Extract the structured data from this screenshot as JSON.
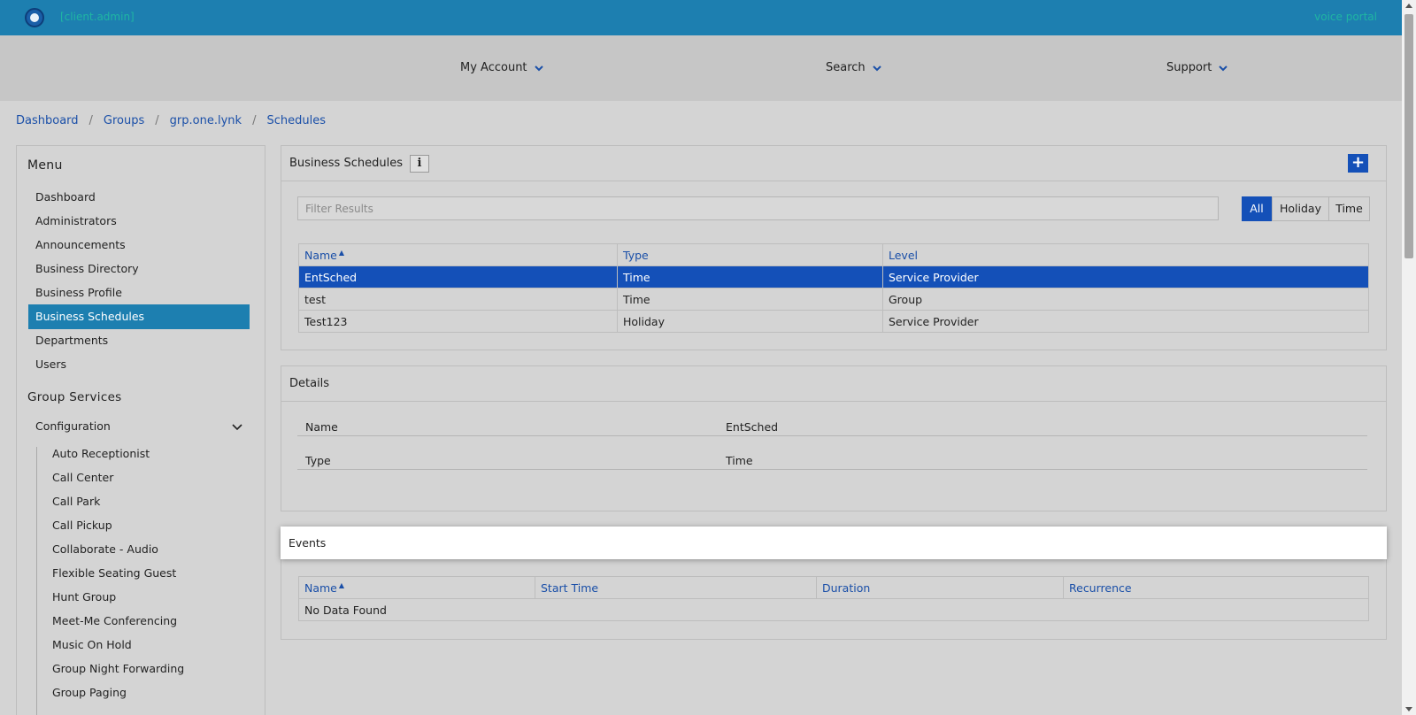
{
  "header": {
    "user": "[client.admin]",
    "portal": "voice portal"
  },
  "nav": [
    {
      "label": "My Account"
    },
    {
      "label": "Search"
    },
    {
      "label": "Support"
    }
  ],
  "breadcrumb": [
    "Dashboard",
    "Groups",
    "grp.one.lynk",
    "Schedules"
  ],
  "sidebar": {
    "menu_title": "Menu",
    "items": [
      "Dashboard",
      "Administrators",
      "Announcements",
      "Business Directory",
      "Business Profile",
      "Business Schedules",
      "Departments",
      "Users"
    ],
    "active_item": "Business Schedules",
    "group_services_title": "Group Services",
    "configuration_label": "Configuration",
    "sub_items": [
      "Auto Receptionist",
      "Call Center",
      "Call Park",
      "Call Pickup",
      "Collaborate - Audio",
      "Flexible Seating Guest",
      "Hunt Group",
      "Meet-Me Conferencing",
      "Music On Hold",
      "Group Night Forwarding",
      "Group Paging"
    ]
  },
  "schedules_panel": {
    "title": "Business Schedules",
    "info_label": "i",
    "add_label": "+",
    "filter_placeholder": "Filter Results",
    "filters": [
      "All",
      "Holiday",
      "Time"
    ],
    "active_filter": "All",
    "columns": [
      "Name",
      "Type",
      "Level"
    ],
    "rows": [
      {
        "name": "EntSched",
        "type": "Time",
        "level": "Service Provider"
      },
      {
        "name": "test",
        "type": "Time",
        "level": "Group"
      },
      {
        "name": "Test123",
        "type": "Holiday",
        "level": "Service Provider"
      }
    ],
    "selected_row": 0
  },
  "details_panel": {
    "title": "Details",
    "fields": [
      {
        "label": "Name",
        "value": "EntSched"
      },
      {
        "label": "Type",
        "value": "Time"
      }
    ]
  },
  "events_panel": {
    "title": "Events",
    "columns": [
      "Name",
      "Start Time",
      "Duration",
      "Recurrence"
    ],
    "empty_text": "No Data Found"
  },
  "colors": {
    "topbar": "#1d7fb0",
    "accent": "#1450b8",
    "link": "#1a4fa8",
    "portal_text": "#1fb5a3"
  }
}
